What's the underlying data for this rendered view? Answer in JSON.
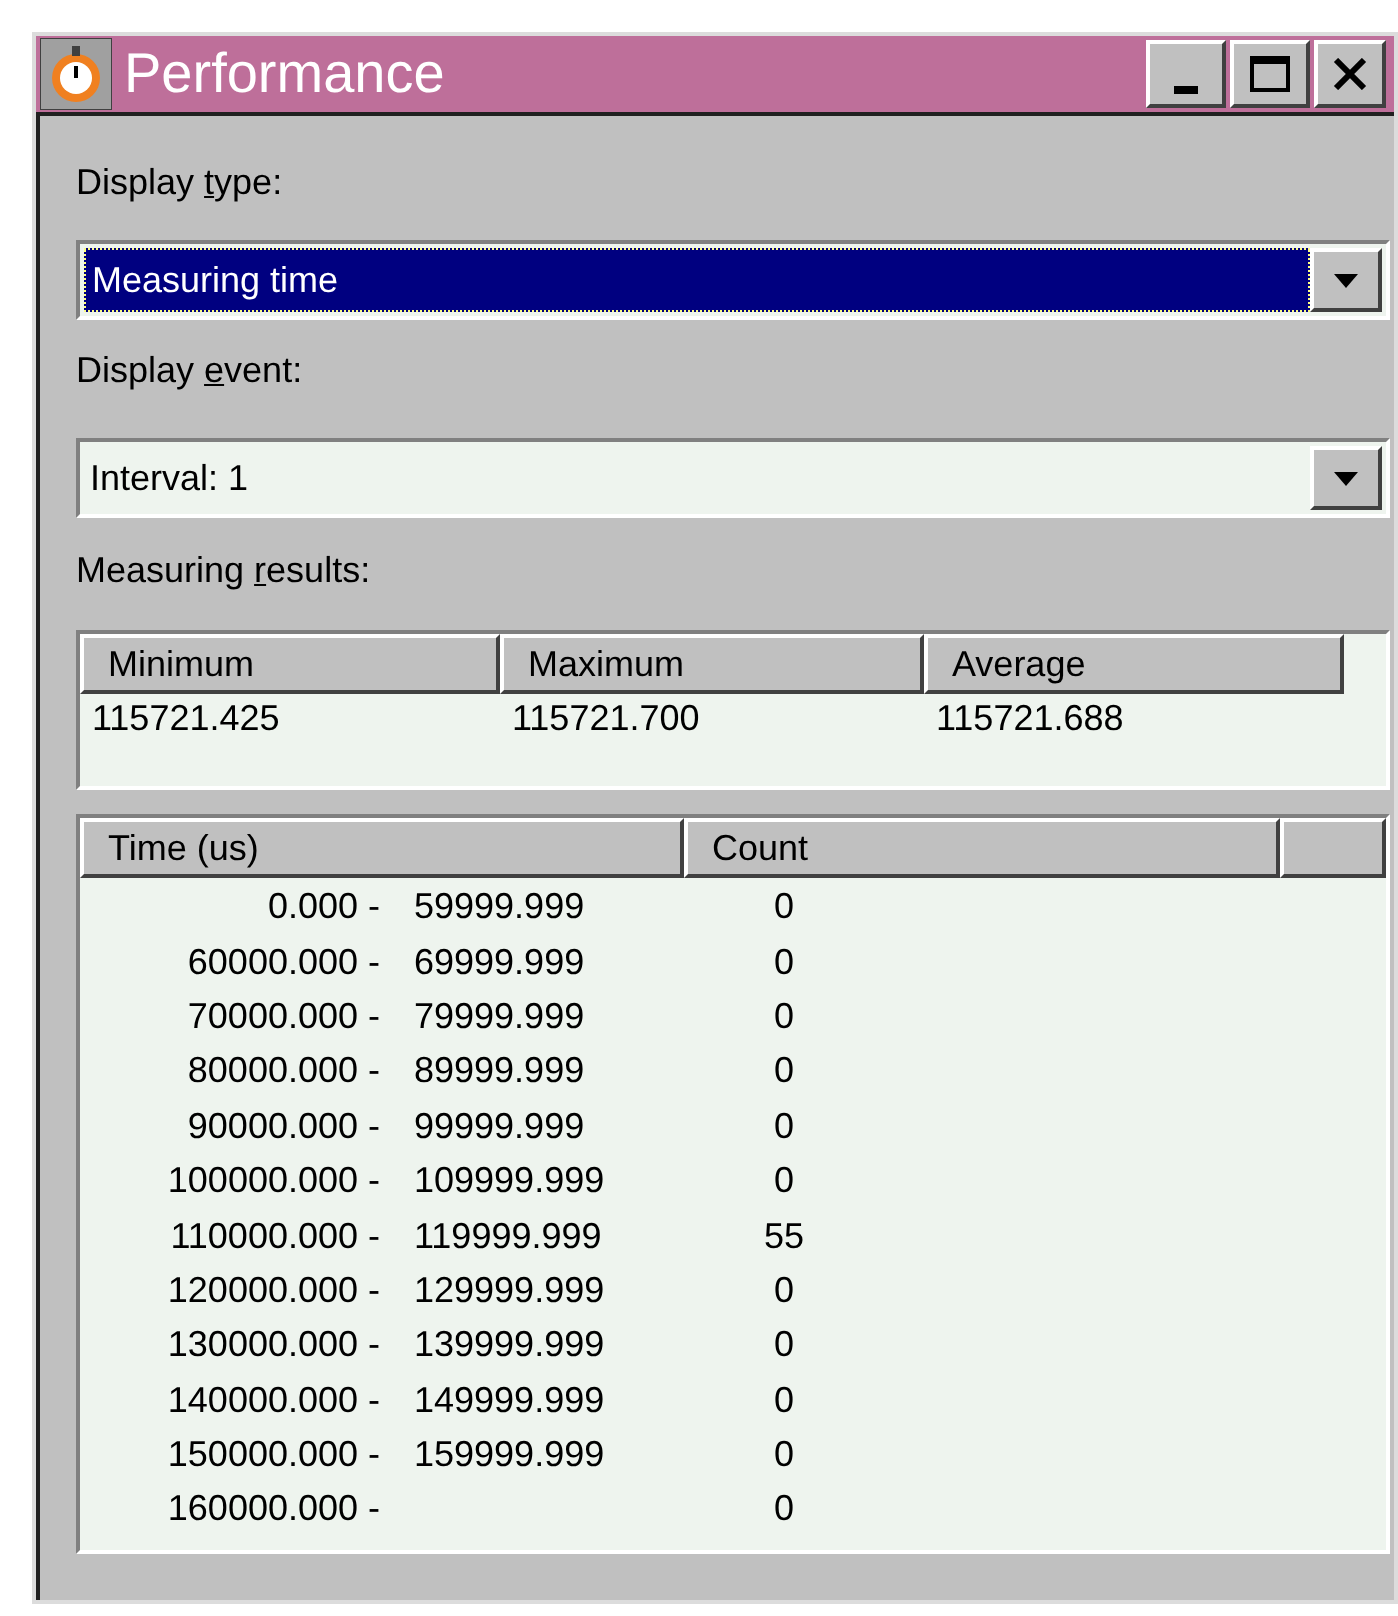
{
  "window": {
    "title": "Performance"
  },
  "display_type": {
    "label_pre": "Display ",
    "label_key": "t",
    "label_post": "ype:",
    "value": "Measuring time",
    "focused": true
  },
  "display_event": {
    "label_pre": "Display ",
    "label_key": "e",
    "label_post": "vent:",
    "value": "Interval: 1",
    "focused": false
  },
  "results_label": {
    "label_pre": "Measuring ",
    "label_key": "r",
    "label_post": "esults:"
  },
  "results": {
    "columns": [
      "Minimum",
      "Maximum",
      "Average"
    ],
    "rows": [
      [
        "115721.425",
        "115721.700",
        "115721.688"
      ]
    ]
  },
  "histogram": {
    "columns": [
      "Time (us)",
      "Count"
    ],
    "rows": [
      {
        "from": "0.000 -",
        "to": "59999.999",
        "count": "0"
      },
      {
        "from": "60000.000 -",
        "to": "69999.999",
        "count": "0"
      },
      {
        "from": "70000.000 -",
        "to": "79999.999",
        "count": "0"
      },
      {
        "from": "80000.000 -",
        "to": "89999.999",
        "count": "0"
      },
      {
        "from": "90000.000 -",
        "to": "99999.999",
        "count": "0"
      },
      {
        "from": "100000.000 -",
        "to": "109999.999",
        "count": "0"
      },
      {
        "from": "110000.000 -",
        "to": "119999.999",
        "count": "55"
      },
      {
        "from": "120000.000 -",
        "to": "129999.999",
        "count": "0"
      },
      {
        "from": "130000.000 -",
        "to": "139999.999",
        "count": "0"
      },
      {
        "from": "140000.000 -",
        "to": "149999.999",
        "count": "0"
      },
      {
        "from": "150000.000 -",
        "to": "159999.999",
        "count": "0"
      },
      {
        "from": "160000.000 -",
        "count": "0"
      }
    ]
  }
}
